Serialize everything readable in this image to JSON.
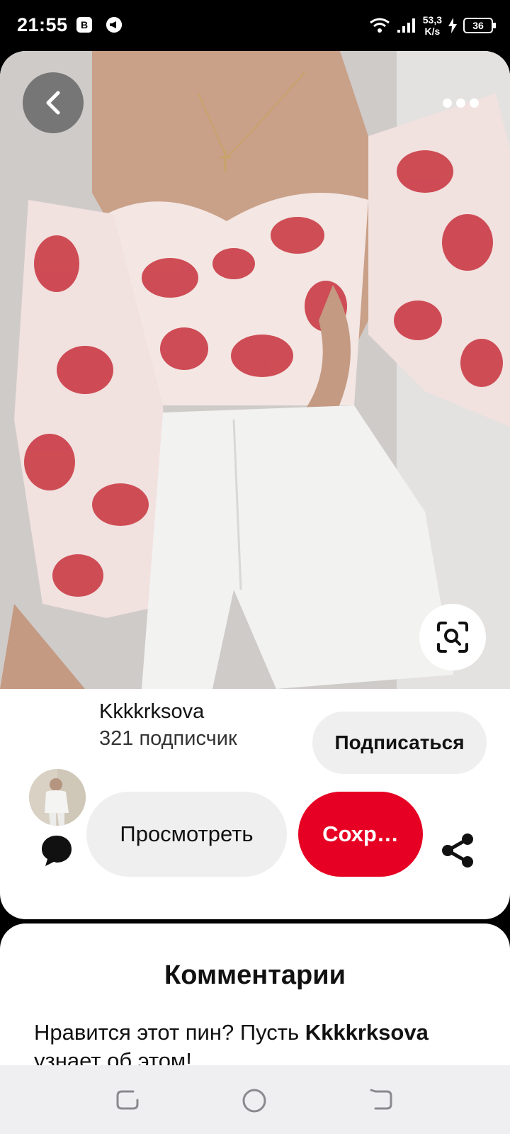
{
  "status_bar": {
    "time": "21:55",
    "app_icon_1": "B",
    "network_speed_value": "53,3",
    "network_speed_unit": "K/s",
    "battery": "36"
  },
  "pin": {
    "image_description_icon": "photo",
    "back_icon": "chevron-left-icon",
    "more_icon": "ellipsis-icon",
    "lens_icon": "visual-search-icon"
  },
  "author": {
    "name": "Kkkkrksova",
    "followers": "321 подписчик",
    "follow_label": "Подписаться"
  },
  "actions": {
    "view_label": "Просмотреть",
    "save_label": "Сохр…",
    "accent_color": "#e60023"
  },
  "comments": {
    "title": "Комментарии",
    "prompt_before": "Нравится этот пин? Пусть ",
    "prompt_name": "Kkkkrksova",
    "prompt_after": " узнает об этом!"
  }
}
